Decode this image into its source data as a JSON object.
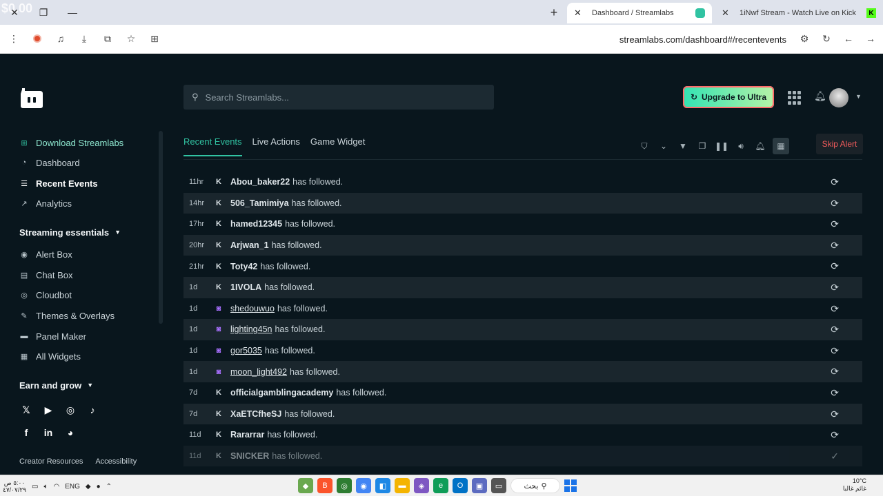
{
  "browser": {
    "overlay_text": "$0.00",
    "tabs": [
      {
        "title": "Dashboard / Streamlabs"
      },
      {
        "title": "1iNwf Stream - Watch Live on Kick"
      }
    ],
    "url": "streamlabs.com/dashboard#/recentevents"
  },
  "header": {
    "search_placeholder": "Search Streamlabs...",
    "upgrade_label": "Upgrade to Ultra"
  },
  "sidebar": {
    "download_label": "Download Streamlabs",
    "items": [
      {
        "label": "Dashboard"
      },
      {
        "label": "Recent Events"
      },
      {
        "label": "Analytics"
      }
    ],
    "streaming_essentials": "Streaming essentials",
    "essentials_items": [
      {
        "label": "Alert Box"
      },
      {
        "label": "Chat Box"
      },
      {
        "label": "Cloudbot"
      },
      {
        "label": "Themes & Overlays"
      },
      {
        "label": "Panel Maker"
      },
      {
        "label": "All Widgets"
      }
    ],
    "earn_and_grow": "Earn and grow",
    "social_icons": [
      "x-icon",
      "youtube-icon",
      "instagram-icon",
      "tiktok-icon",
      "facebook-icon",
      "linkedin-icon",
      "discord-icon"
    ],
    "footer_links": [
      "Creator Resources",
      "Accessibility"
    ]
  },
  "tabs": [
    {
      "label": "Recent Events"
    },
    {
      "label": "Live Actions"
    },
    {
      "label": "Game Widget"
    }
  ],
  "skip_alert": "Skip Alert",
  "events": [
    {
      "time": "11hr",
      "platform": "kick",
      "name": "Abou_baker22",
      "action": "has followed."
    },
    {
      "time": "14hr",
      "platform": "kick",
      "name": "506_Tamimiya",
      "action": "has followed."
    },
    {
      "time": "17hr",
      "platform": "kick",
      "name": "hamed12345",
      "action": "has followed."
    },
    {
      "time": "20hr",
      "platform": "kick",
      "name": "Arjwan_1",
      "action": "has followed."
    },
    {
      "time": "21hr",
      "platform": "kick",
      "name": "Toty42",
      "action": "has followed."
    },
    {
      "time": "1d",
      "platform": "kick",
      "name": "1IVOLA",
      "action": "has followed."
    },
    {
      "time": "1d",
      "platform": "twitch",
      "name": "shedouwuo",
      "action": "has followed."
    },
    {
      "time": "1d",
      "platform": "twitch",
      "name": "lighting45n",
      "action": "has followed."
    },
    {
      "time": "1d",
      "platform": "twitch",
      "name": "gor5035",
      "action": "has followed."
    },
    {
      "time": "1d",
      "platform": "twitch",
      "name": "moon_light492",
      "action": "has followed."
    },
    {
      "time": "7d",
      "platform": "kick",
      "name": "officialgamblingacademy",
      "action": "has followed."
    },
    {
      "time": "7d",
      "platform": "kick",
      "name": "XaETCfheSJ",
      "action": "has followed."
    },
    {
      "time": "11d",
      "platform": "kick",
      "name": "Rararrar",
      "action": "has followed."
    },
    {
      "time": "11d",
      "platform": "kick",
      "name": "SNICKER",
      "action": "has followed."
    }
  ],
  "taskbar": {
    "lang": "ENG",
    "search_label": "بحث",
    "clock_time": "٥:٠٠ ص",
    "clock_date": "٤٧/٠٧/٢٩",
    "weather_temp": "10°C",
    "weather_text": "غائم غالبا"
  }
}
